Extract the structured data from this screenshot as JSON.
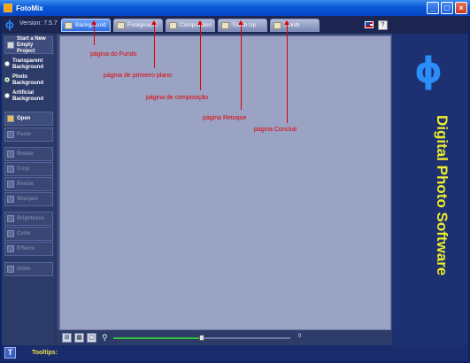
{
  "window": {
    "title": "FotoMix",
    "minimize": "_",
    "maximize": "□",
    "close": "×"
  },
  "header": {
    "version": "Version: 7.5.7",
    "tabs": [
      {
        "label": "Background",
        "active": true
      },
      {
        "label": "Foreground",
        "active": false
      },
      {
        "label": "Composition",
        "active": false
      },
      {
        "label": "Touch Up",
        "active": false
      },
      {
        "label": "Finish",
        "active": false
      }
    ],
    "help": "?"
  },
  "sidebar": {
    "new_project": "Start a New Empty Project",
    "radios": [
      {
        "label": "Transparent Background",
        "checked": false
      },
      {
        "label": "Photo Background",
        "checked": true
      },
      {
        "label": "Artificial Background",
        "checked": false
      }
    ],
    "open": "Open",
    "paste": "Paste",
    "tools": [
      "Rotate",
      "Crop",
      "Resize",
      "Sharpen",
      "Brightness",
      "Color",
      "Effects",
      "Undo"
    ]
  },
  "bottombar": {
    "zoom_value": "0",
    "zoom_level": 0.5
  },
  "right_panel": {
    "brand": "Digital Photo Software"
  },
  "statusbar": {
    "tooltips_label": "Tooltips:"
  },
  "annotations": [
    "página do Fundo",
    "página de primeiro plano",
    "página de composição",
    "página Retoque",
    "página Concluir"
  ],
  "colors": {
    "accent_blue": "#2b8df7",
    "brand_yellow": "#ecec2a",
    "annotation_red": "#e00000",
    "slider_green": "#38c03a"
  }
}
